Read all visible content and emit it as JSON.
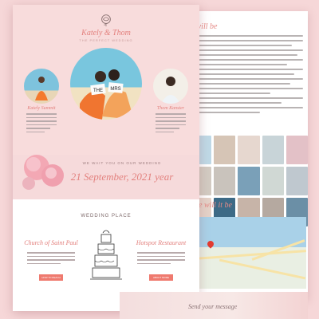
{
  "front": {
    "couple_names": "Kately & Thom",
    "tagline": "THE PERFECT WEDDING",
    "bride": {
      "name": "Kately Summit"
    },
    "groom": {
      "name": "Thom Kanster"
    },
    "sign_left": "THE",
    "sign_right": "MRS",
    "date_label": "WE WAIT YOU ON OUR WEDDING",
    "date_value": "21 September, 2021 year",
    "place_title": "WEDDING PLACE",
    "venues": [
      {
        "name": "Church of Saint Paul",
        "button": "HOW TO REACH"
      },
      {
        "name": "Hotspot Restaurant",
        "button": "ABOUT MORE"
      }
    ]
  },
  "back": {
    "heading_1": "...will be",
    "heading_2": "...re will it be",
    "gallery_colors": [
      "#bfd9e6",
      "#d6c5b6",
      "#e6d7cf",
      "#c8d4d8",
      "#e3c1c7",
      "#d2cbc2",
      "#c9c3bc",
      "#7aa0b8",
      "#d0d8d4",
      "#bfc8cf",
      "#e4d2c8",
      "#3d6a86",
      "#c7b4a8",
      "#b5a9a0",
      "#6b8fa6"
    ]
  },
  "footer": {
    "send": "Send your message"
  },
  "colors": {
    "accent": "#e3817e",
    "button": "#ef7a6f",
    "bg": "#f6d7d8"
  }
}
